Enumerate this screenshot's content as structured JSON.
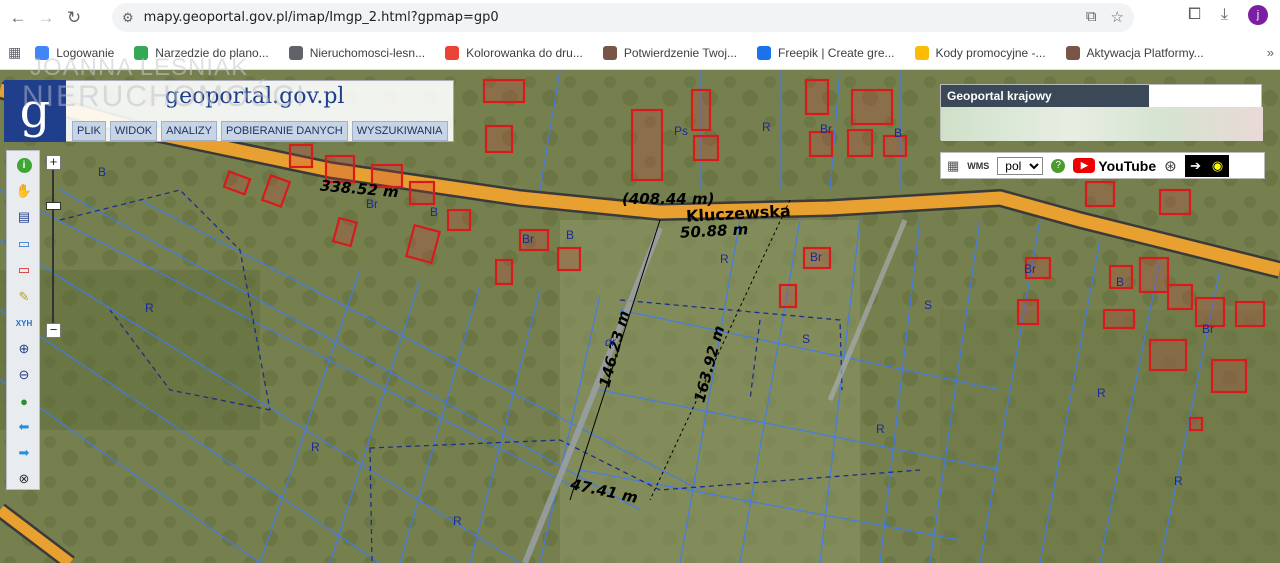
{
  "browser": {
    "url": "mapy.geoportal.gov.pl/imap/Imgp_2.html?gpmap=gp0",
    "profile_initial": "j"
  },
  "bookmarks": [
    {
      "label": "Logowanie",
      "color": "#4285f4"
    },
    {
      "label": "Narzedzie do plano...",
      "color": "#34a853"
    },
    {
      "label": "Nieruchomosci-lesn...",
      "color": "#5f6368"
    },
    {
      "label": "Kolorowanka do dru...",
      "color": "#ea4335"
    },
    {
      "label": "Potwierdzenie Twoj...",
      "color": "#795548"
    },
    {
      "label": "Freepik | Create gre...",
      "color": "#1a73e8"
    },
    {
      "label": "Kody promocyjne -...",
      "color": "#fbbc05"
    },
    {
      "label": "Aktywacja Platformy...",
      "color": "#795548"
    }
  ],
  "bookmarks_more": "»",
  "watermark": {
    "line1": "JOANNA LEŚNIAK",
    "line2": "NIERUCHOMOŚCI"
  },
  "geoportal": {
    "logo_letter": "g",
    "site_name": "geoportal.gov.pl",
    "menu": [
      "PLIK",
      "WIDOK",
      "ANALIZY",
      "POBIERANIE DANYCH",
      "WYSZUKIWANIA"
    ],
    "krajowy_label": "Geoportal krajowy",
    "language": "pol",
    "youtube_label": "YouTube",
    "zoom_in": "+",
    "zoom_out": "−"
  },
  "map_labels": {
    "street": "Kluczewska",
    "measures": [
      {
        "text": "338.52 m"
      },
      {
        "text": "(408.44 m)"
      },
      {
        "text": "50.88 m"
      },
      {
        "text": "146.23 m"
      },
      {
        "text": "163.92 m"
      },
      {
        "text": "47.41 m"
      }
    ],
    "plot_codes": [
      "B",
      "Br",
      "Ps",
      "R",
      "S",
      "dr"
    ]
  },
  "colors": {
    "road": "#e8a030",
    "parcel_line": "#3a7bff",
    "building_outline": "#d91a1a",
    "geoportal_blue": "#1f3e8c"
  }
}
